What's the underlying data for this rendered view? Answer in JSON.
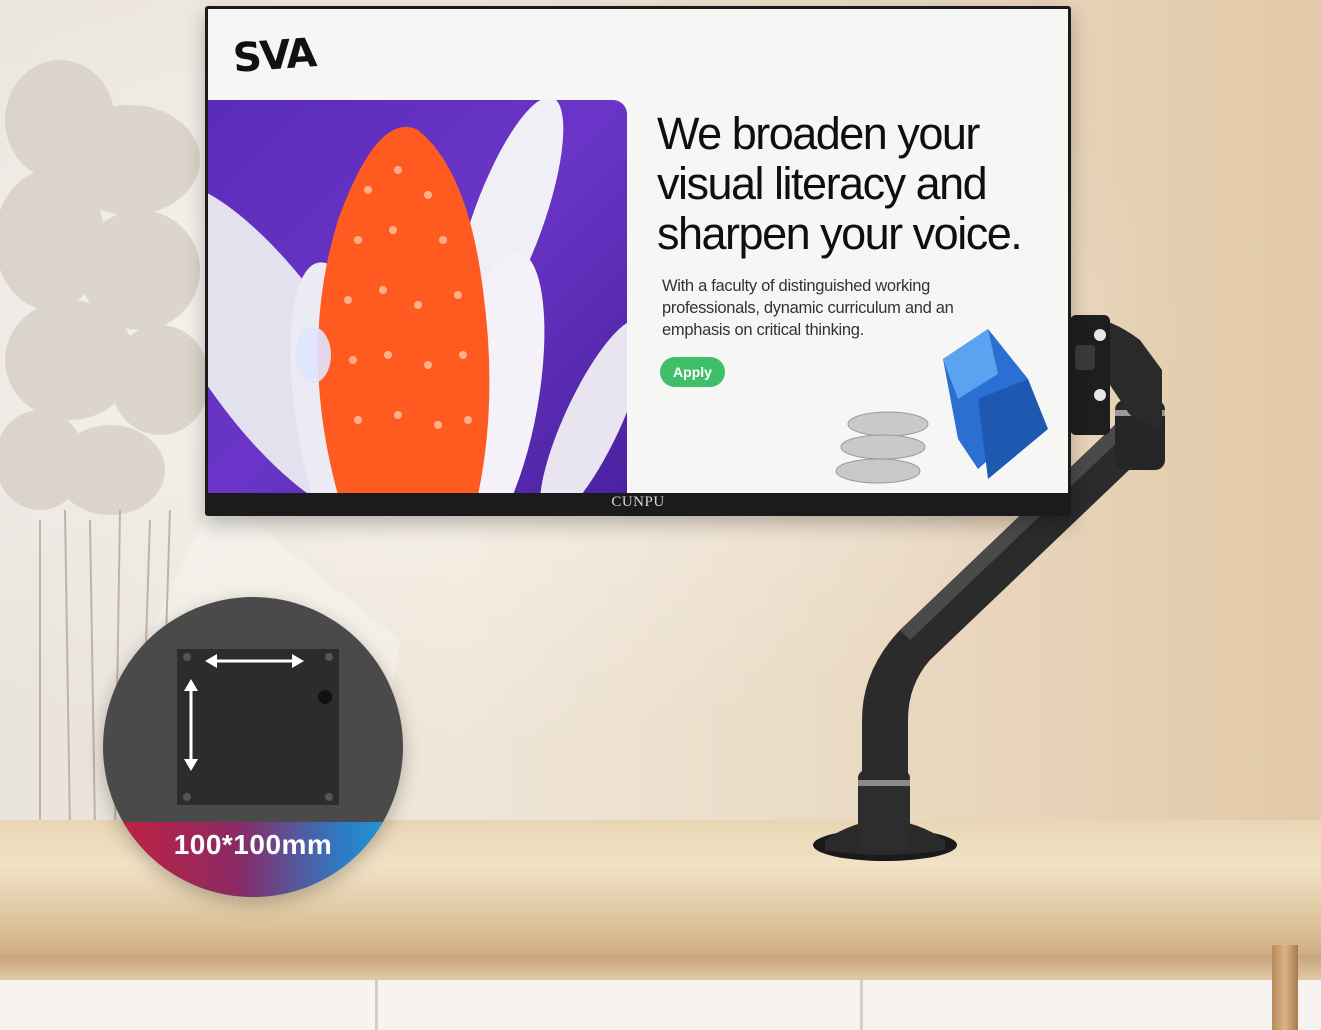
{
  "monitor": {
    "brand": "CUNPU",
    "screen": {
      "logo": "SVA",
      "headline": "We broaden your visual literacy and sharpen your voice.",
      "body": "With a faculty of distinguished working professionals, dynamic curriculum and an emphasis on critical thinking.",
      "apply_label": "Apply"
    }
  },
  "detail": {
    "label": "100*100mm"
  },
  "colors": {
    "apply_button": "#3fbf6a",
    "hero_purple": "#5a2bb8",
    "hero_orange": "#ff5a1f",
    "band_red": "#c8203a",
    "band_blue": "#1ea0d8"
  }
}
